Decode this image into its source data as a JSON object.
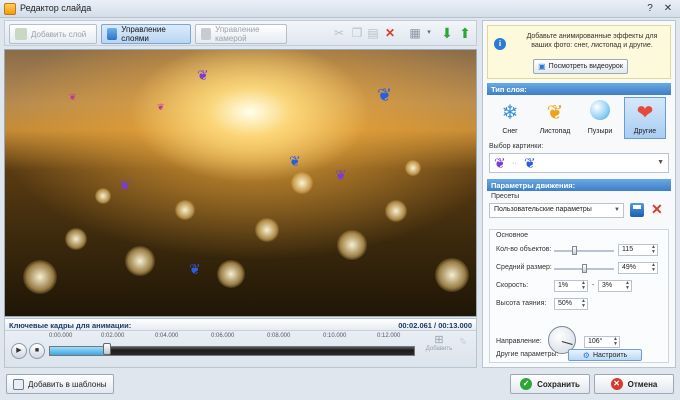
{
  "window": {
    "title": "Редактор слайда"
  },
  "toolbar": {
    "add_layer": "Добавить слой",
    "manage_layers": "Управление слоями",
    "manage_camera": "Управление камерой"
  },
  "timeline": {
    "title": "Ключевые кадры для анимации:",
    "time": "00:02.061 / 00:13.000",
    "ticks": [
      "0:00.000",
      "0:02.000",
      "0:04.000",
      "0:06.000",
      "0:08.000",
      "0:10.000",
      "0:12.000"
    ],
    "progress": 0.16,
    "add_label": "Добавить"
  },
  "bottom": {
    "add_to_templates": "Добавить в шаблоны",
    "save": "Сохранить",
    "cancel": "Отмена"
  },
  "panel": {
    "hint_text": "Добавьте анимированные эффекты для ваших фото: снег, листопад и другие.",
    "hint_button": "Посмотреть видеоурок",
    "layer_type_head": "Тип слоя:",
    "types": [
      "Снег",
      "Листопад",
      "Пузыри",
      "Другие"
    ],
    "selected_type": "Другие",
    "picture_label": "Выбор картинки:",
    "motion_head": "Параметры движения:",
    "presets_label": "Пресеты",
    "preset_value": "Пользовательские параметры",
    "basic_label": "Основное",
    "count_label": "Кол-во объектов:",
    "count_value": "115",
    "size_label": "Средний размер:",
    "size_value": "49%",
    "speed_label": "Скорость:",
    "speed_from": "1%",
    "speed_to": "3%",
    "speed_sep": "-",
    "melt_label": "Высота таяния:",
    "melt_value": "50%",
    "direction_label": "Направление:",
    "direction_value": "106°",
    "other_label": "Другие параметры:",
    "setup_button": "Настроить"
  },
  "colors": {
    "accent": "#3d7fc7",
    "hint_bg": "#fdf9dc",
    "delete": "#d63c2c",
    "ok": "#2fa43a"
  },
  "icons": [
    "app-icon",
    "add-layer-icon",
    "layers-icon",
    "camera-icon",
    "cut-icon",
    "copy-icon",
    "paste-icon",
    "delete-icon",
    "grid-icon",
    "down-arrow-icon",
    "up-arrow-icon",
    "play-icon",
    "stop-icon",
    "info-icon",
    "video-icon",
    "save-icon",
    "settings-icon",
    "check-icon",
    "close-icon"
  ]
}
